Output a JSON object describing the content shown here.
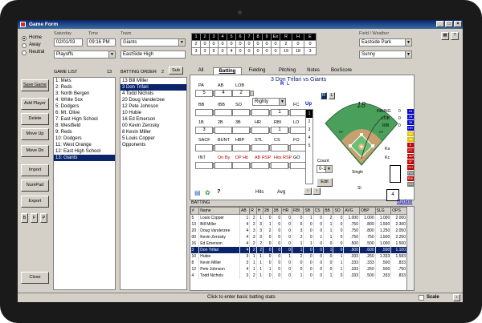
{
  "window": {
    "title": "Game Form"
  },
  "home_away": {
    "options": [
      "Home",
      "Away",
      "Neutral"
    ],
    "selected": "Home"
  },
  "game_info": {
    "date_label": "Saturday",
    "time_label": "Time",
    "date": "02/01/03",
    "time": "09:16 PM",
    "game_type": "Playoffs",
    "team_label": "Team",
    "team": "Giants",
    "opponent": "EastSide High",
    "field_label": "Field / Weather",
    "field": "Eastside Park",
    "weather": "Sunny"
  },
  "scoreboard": {
    "headers": [
      "1",
      "2",
      "3",
      "4",
      "5",
      "6",
      "7",
      "8",
      "9",
      "Ex",
      "R",
      "H",
      "E"
    ],
    "rows": [
      [
        "2",
        "0",
        "0",
        "0",
        "0",
        "0",
        "0",
        "0",
        "0",
        "0",
        "2",
        "0",
        "0"
      ],
      [
        "3",
        "3",
        "9",
        "0",
        "4",
        "0",
        "0",
        "0",
        "0",
        "0",
        "19",
        "18",
        "3"
      ]
    ]
  },
  "left_buttons": [
    "Save Game",
    "Add Player",
    "Delete",
    "Move Up",
    "Move Dn",
    "Import",
    "NumPad",
    "Export",
    "Close"
  ],
  "small_buttons": [
    "B",
    "F",
    "P"
  ],
  "game_list": {
    "label": "GAME LIST",
    "count": "13",
    "items": [
      "1: Mets",
      "2: Reds",
      "3: North Bergen",
      "4: White Sox",
      "5: Dodgers",
      "6: Mt. Olive",
      "7: East High School",
      "8: Westfield",
      "9: Reds",
      "10: Dodgers",
      "11: West Orange",
      "12: East High School",
      "13: Giants"
    ],
    "selected": 12
  },
  "batting_order": {
    "label": "BATTING ORDER",
    "count": "2",
    "sub_label": "Sub",
    "items": [
      "13 Bill Miller",
      "3 Don Trifari",
      "4 Todd Nichols",
      "20 Doug Vanderzee",
      "12 Pete Johnson",
      "10 Hubie",
      "16 Ed Emerson",
      "00 Kevin Zerosky",
      "8 Kevin Miller",
      "5 Louis Copper",
      "Opponents"
    ],
    "selected": 1
  },
  "tabs": [
    "All",
    "Batting",
    "Fielding",
    "Pitching",
    "Notes",
    "BoxScore"
  ],
  "active_tab": "Batting",
  "matchup": "3 Don Trifari vs Giants",
  "stats": {
    "labels": [
      "PA",
      "AB",
      "LOB",
      "SIDE",
      "BB",
      "IBB",
      "SO",
      "SOS",
      "RUNS",
      "FC",
      "1B",
      "2B",
      "3B",
      "HR",
      "RBI",
      "LO",
      "SACF",
      "BUNT",
      "HBP",
      "STL",
      "CS",
      "FO",
      "INT",
      "On By",
      "DP Hit",
      "AB RSP",
      "Hits RSP",
      "GO"
    ],
    "pa": "5",
    "ab": "4",
    "lob": "2",
    "side": "Righty",
    "side_r": "R",
    "side_l": "L",
    "runs": "1",
    "one_b": "3",
    "rbi": "1",
    "hits": "Hits",
    "avg": "Avg",
    "up_label": "Up"
  },
  "inning_box": {
    "inning": "INNING",
    "lob": "LOB",
    "rbi": "RBI",
    "inning_v": "0",
    "lob_v": "0",
    "rbi_v": "0"
  },
  "field_diagram": {
    "count_label": "Count",
    "count": "0-1",
    "edit": "Edit",
    "result": "Single",
    "play_no": "18",
    "si": "SI",
    "ks": "Ks",
    "kc": "Kc",
    "pos": "4",
    "bp": "BP"
  },
  "side_labels": [
    "1B",
    "2B",
    "3B",
    "HR",
    "BB",
    "SB",
    "E",
    "FC",
    "HBP",
    "SF",
    "SH",
    "FO",
    "RBI",
    "GO"
  ],
  "batting_table": {
    "label": "BATTING",
    "update": "Update",
    "headers": [
      "#",
      "Name",
      "AB",
      "R",
      "H",
      "2B",
      "3B",
      "HR",
      "RBI",
      "SB",
      "CS",
      "BB",
      "SO",
      "AVG",
      "OBP",
      "SLG",
      "OPS"
    ],
    "rows": [
      [
        "5",
        "Louis Copper",
        "1",
        "2",
        "1",
        "0",
        "0",
        "0",
        "0",
        "1",
        "0",
        "2",
        "0",
        "1.000",
        "1.000",
        "1.000",
        "2.000"
      ],
      [
        "13",
        "Bill Miller",
        "4",
        "2",
        "3",
        "1",
        "0",
        "0",
        "6",
        "0",
        "0",
        "1",
        "0",
        ".750",
        ".800",
        "1.500",
        "2.300"
      ],
      [
        "20",
        "Doug Vanderzee",
        "4",
        "3",
        "3",
        "2",
        "0",
        "0",
        "3",
        "0",
        "0",
        "1",
        "0",
        ".750",
        ".800",
        "1.250",
        "2.050"
      ],
      [
        "00",
        "Kevin Zerosky",
        "4",
        "3",
        "3",
        "0",
        "0",
        "0",
        "2",
        "0",
        "1",
        "1",
        "0",
        ".750",
        ".750",
        "1.500",
        "2.250"
      ],
      [
        "16",
        "Ed Emerson",
        "4",
        "2",
        "2",
        "0",
        "0",
        "0",
        "1",
        "1",
        "0",
        "0",
        "0",
        ".500",
        ".500",
        "1.000",
        "1.500"
      ],
      [
        "3",
        "Don Trifari",
        "4",
        "2",
        "2",
        "0",
        "0",
        "0",
        "1",
        "0",
        "0",
        "1",
        "0",
        ".500",
        ".600",
        ".500",
        "1.100"
      ],
      [
        "10",
        "Hubie",
        "3",
        "1",
        "1",
        "0",
        "0",
        "1",
        "2",
        "0",
        "0",
        "0",
        "1",
        ".333",
        ".250",
        "1.333",
        "1.583"
      ],
      [
        "8",
        "Kevin Miller",
        "3",
        "1",
        "1",
        "0",
        "0",
        "0",
        "0",
        "0",
        "0",
        "0",
        "1",
        ".333",
        ".333",
        ".500",
        ".833"
      ],
      [
        "12",
        "Pete Johnson",
        "4",
        "1",
        "1",
        "1",
        "0",
        "0",
        "0",
        "0",
        "0",
        "0",
        "1",
        ".333",
        ".250",
        ".500",
        ".750"
      ],
      [
        "4",
        "Todd Nichols",
        "3",
        "2",
        "1",
        "0",
        "0",
        "0",
        "1",
        "0",
        "0",
        "1",
        "0",
        ".333",
        ".500",
        ".333",
        ".833"
      ]
    ],
    "selected": 5
  },
  "status": {
    "text": "Click to enter basic batting stats",
    "scale": "Scale"
  },
  "colors": {
    "title_bar": "#0a246a",
    "selection": "#0a246a",
    "grass": "#4aa05a",
    "dirt": "#c8a070"
  }
}
